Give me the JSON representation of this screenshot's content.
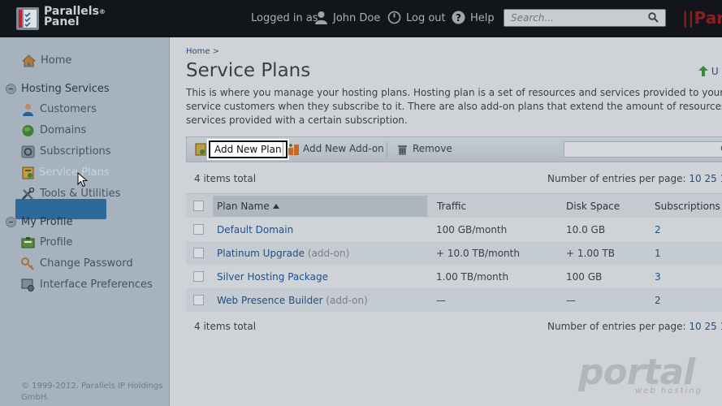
{
  "header": {
    "logo_line1": "Parallels",
    "logo_sup": "®",
    "logo_line2": "Panel",
    "logged_in_label": "Logged in as",
    "user_name": "John Doe",
    "logout_label": "Log out",
    "help_label": "Help",
    "search_placeholder": "Search...",
    "brand_right": "||Par"
  },
  "sidebar": {
    "home": "Home",
    "hosting_services": "Hosting Services",
    "customers": "Customers",
    "domains": "Domains",
    "subscriptions": "Subscriptions",
    "service_plans": "Service Plans",
    "tools": "Tools & Utilities",
    "my_profile": "My Profile",
    "profile": "Profile",
    "change_password": "Change Password",
    "interface_prefs": "Interface Preferences",
    "copyright_line1": "© 1999-2012. Parallels IP Holdings",
    "copyright_line2": "GmbH."
  },
  "main": {
    "breadcrumb_home": "Home",
    "breadcrumb_sep": ">",
    "title": "Service Plans",
    "up_link": "U",
    "desc_line1": "This is where you manage your hosting plans. Hosting plan is a set of resources and services provided to your ho",
    "desc_line2": "service customers when they subscribe to it. There are also add-on plans that extend the amount of resources a",
    "desc_line3": "services provided with a certain subscription.",
    "toolbar": {
      "add_plan": "Add New Plan",
      "add_addon": "Add New Add-on",
      "remove": "Remove"
    },
    "items_total": "4 items total",
    "per_page_label": "Number of entries per page:",
    "per_page_10": "10",
    "per_page_25": "25",
    "per_page_100": "1",
    "columns": {
      "plan_name": "Plan Name",
      "traffic": "Traffic",
      "disk_space": "Disk Space",
      "subscriptions": "Subscriptions"
    },
    "rows": [
      {
        "name": "Default Domain",
        "addon": "",
        "traffic": "100 GB/month",
        "disk": "10.0 GB",
        "subs": "2"
      },
      {
        "name": "Platinum Upgrade",
        "addon": "(add-on)",
        "traffic": "+ 10.0 TB/month",
        "disk": "+ 1.00 TB",
        "subs": "1"
      },
      {
        "name": "Silver Hosting Package",
        "addon": "",
        "traffic": "1.00 TB/month",
        "disk": "100 GB",
        "subs": "3"
      },
      {
        "name": "Web Presence Builder",
        "addon": "(add-on)",
        "traffic": "—",
        "disk": "—",
        "subs": "2"
      }
    ]
  },
  "watermark": {
    "text": "portal",
    "sub": "web hosting"
  }
}
